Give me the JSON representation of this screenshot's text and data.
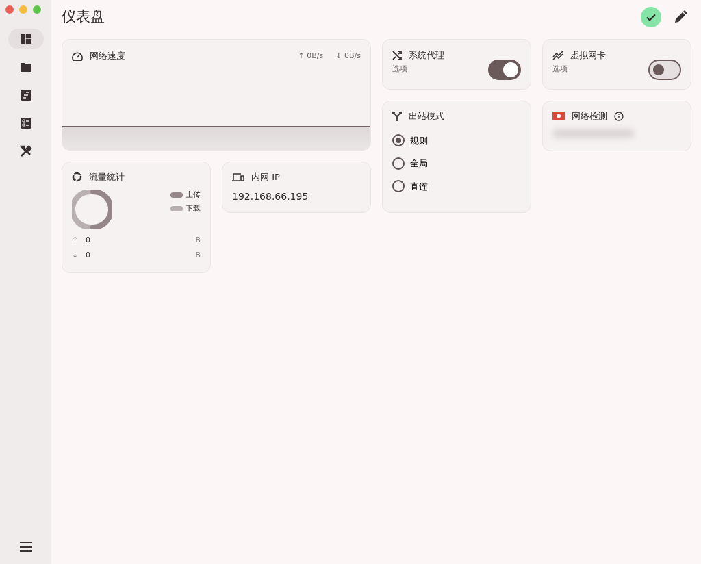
{
  "window": {
    "title": "仪表盘"
  },
  "header": {
    "status_ok": true
  },
  "sidebar": {
    "items": [
      {
        "kind": "dashboard",
        "selected": true
      },
      {
        "kind": "folder",
        "selected": false
      },
      {
        "kind": "logs",
        "selected": false
      },
      {
        "kind": "list",
        "selected": false
      },
      {
        "kind": "tools",
        "selected": false
      }
    ]
  },
  "speed": {
    "title": "网络速度",
    "up": "↑ 0B/s",
    "down": "↓ 0B/s"
  },
  "traffic": {
    "title": "流量统计",
    "legend": [
      "上传",
      "下载"
    ],
    "rows": [
      {
        "arrow": "↑",
        "value": "0",
        "unit": "B"
      },
      {
        "arrow": "↓",
        "value": "0",
        "unit": "B"
      }
    ]
  },
  "lan_ip": {
    "title": "内网 IP",
    "value": "192.168.66.195"
  },
  "system_proxy": {
    "title": "系统代理",
    "label": "选项",
    "on": true
  },
  "tun": {
    "title": "虚拟网卡",
    "label": "选项",
    "on": false
  },
  "outbound": {
    "title": "出站模式",
    "options": [
      {
        "label": "规则",
        "selected": true
      },
      {
        "label": "全局",
        "selected": false
      },
      {
        "label": "直连",
        "selected": false
      }
    ]
  },
  "network_check": {
    "title": "网络检测"
  }
}
